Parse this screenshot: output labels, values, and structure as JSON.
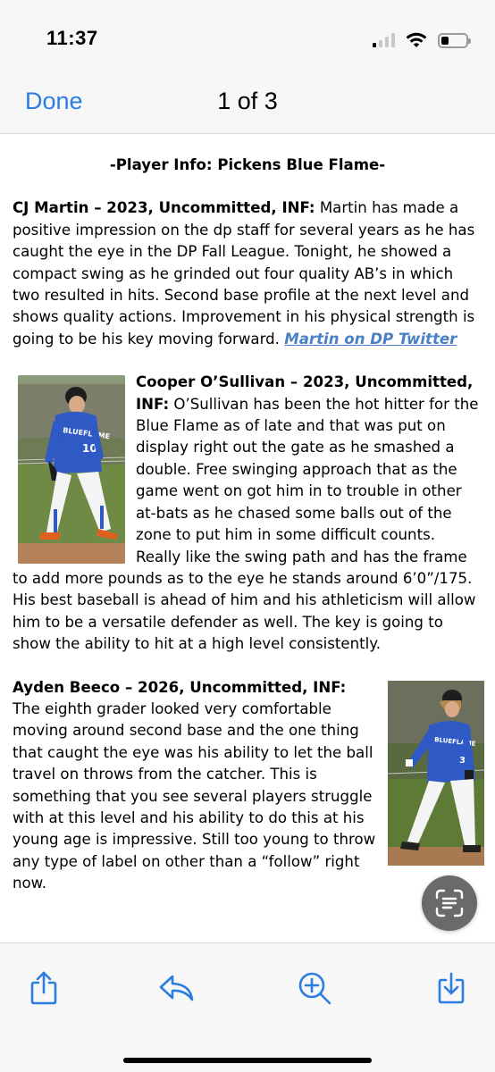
{
  "status_bar": {
    "time": "11:37",
    "icons": [
      "cellular-signal-icon",
      "wifi-icon",
      "battery-icon"
    ],
    "signal_bars_active": 1,
    "signal_bars_total": 4,
    "battery_level": 0.3
  },
  "nav": {
    "done_label": "Done",
    "page_counter": "1 of 3"
  },
  "document": {
    "title": "-Player Info: Pickens Blue Flame-",
    "players": [
      {
        "name": "CJ Martin – 2023, Uncommitted, INF:",
        "text": " Martin has made a positive impression on the dp staff for several years as he has caught the eye in the DP Fall League. Tonight, he showed a compact swing as he grinded out four quality AB’s in which two resulted in hits. Second base profile at the next level and shows quality actions. Improvement in his physical strength is going to be his key moving forward. ",
        "link": "Martin on DP Twitter"
      },
      {
        "name": "Cooper O’Sullivan – 2023, Uncommitted, INF:",
        "text": " O’Sullivan has been the hot hitter for the Blue Flame as of late and that was put on display right out the gate as he smashed a double. Free swinging approach that as the game went on got him in to trouble in other at-bats as he chased some balls out of the zone to put him in some difficult counts. Really like the swing path and has the frame to add more pounds as to the eye he stands around 6’0”/175. His best baseball is ahead of him and his athleticism will allow him to be a versatile defender as well. The key is going to show the ability to hit at a high level consistently."
      },
      {
        "name": "Ayden Beeco – 2026, Uncommitted, INF:",
        "text": " The eighth grader looked very comfortable moving around second base and the one thing that caught the eye was his ability to let the ball travel on throws from the catcher. This is something that you see several players struggle with at this level and his ability to do this at his young age is impressive. Still too young to throw any type of label on other than a “follow” right now."
      }
    ],
    "jersey_text": "BLUEFLAME"
  },
  "toolbar": {
    "icons": [
      "share-icon",
      "reply-icon",
      "zoom-in-icon",
      "save-to-files-icon"
    ]
  },
  "colors": {
    "accent": "#2b7de0",
    "link": "#4a80c4",
    "bar_background": "#f7f7f7",
    "jersey_blue": "#2f59c4"
  }
}
